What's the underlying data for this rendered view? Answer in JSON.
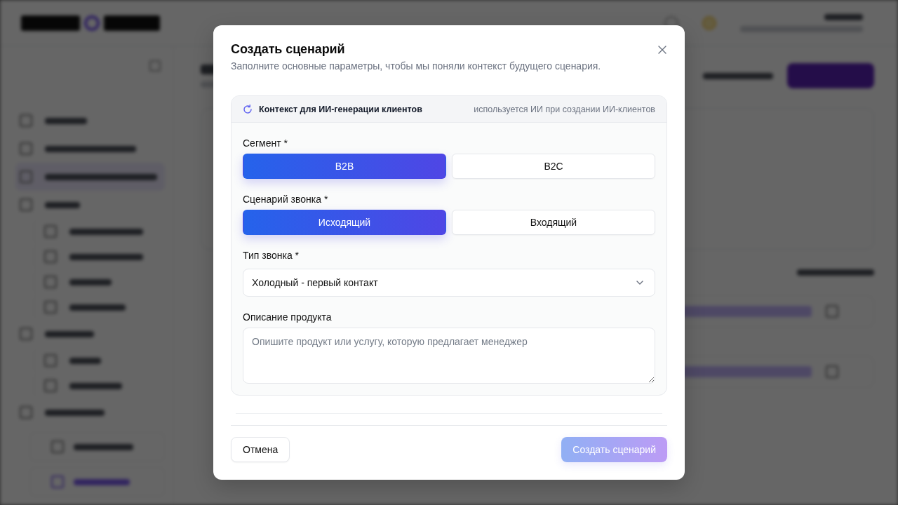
{
  "dialog": {
    "title": "Создать сценарий",
    "subtitle": "Заполните основные параметры, чтобы мы поняли контекст будущего сценария."
  },
  "context_panel": {
    "title": "Контекст для ИИ-генерации клиентов",
    "note": "используется ИИ при создании ИИ-клиентов",
    "fields": [
      {
        "kind": "toggle",
        "label": "Сегмент *",
        "options": [
          {
            "label": "B2B",
            "selected": true
          },
          {
            "label": "B2C",
            "selected": false
          }
        ]
      },
      {
        "kind": "toggle",
        "label": "Сценарий звонка *",
        "options": [
          {
            "label": "Исходящий",
            "selected": true
          },
          {
            "label": "Входящий",
            "selected": false
          }
        ]
      },
      {
        "kind": "select",
        "label": "Тип звонка *",
        "value": "Холодный - первый контакт"
      },
      {
        "kind": "textarea",
        "label": "Описание продукта",
        "placeholder": "Опишите продукт или услугу, которую предлагает менеджер"
      }
    ]
  },
  "footer": {
    "buttons": [
      {
        "kind": "cancel",
        "label": "Отмена",
        "disabled": false
      },
      {
        "kind": "submit",
        "label": "Создать сценарий",
        "disabled": true
      }
    ]
  }
}
